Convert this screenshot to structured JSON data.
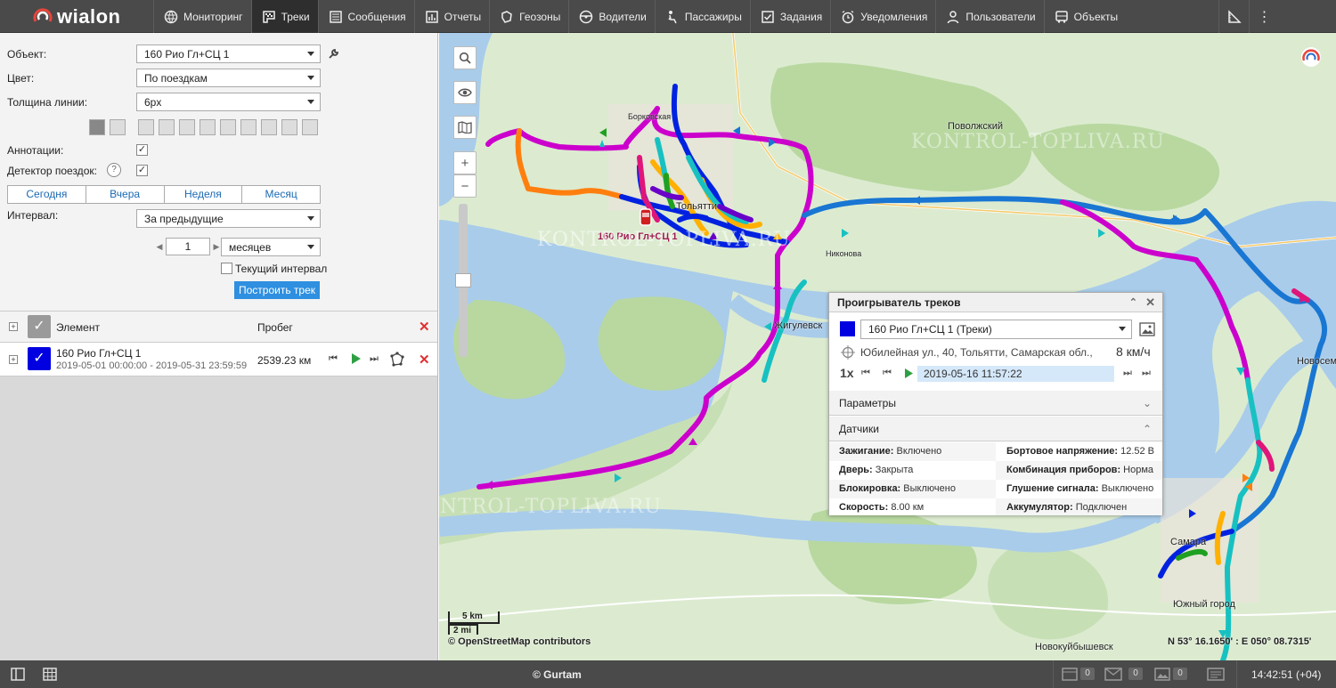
{
  "app": {
    "name": "wialon"
  },
  "nav": {
    "items": [
      {
        "label": "Мониторинг",
        "icon": "globe-icon"
      },
      {
        "label": "Треки",
        "icon": "tracks-icon",
        "active": true
      },
      {
        "label": "Сообщения",
        "icon": "messages-icon"
      },
      {
        "label": "Отчеты",
        "icon": "reports-icon"
      },
      {
        "label": "Геозоны",
        "icon": "geofence-icon"
      },
      {
        "label": "Водители",
        "icon": "steering-wheel-icon"
      },
      {
        "label": "Пассажиры",
        "icon": "passenger-icon"
      },
      {
        "label": "Задания",
        "icon": "tasks-icon"
      },
      {
        "label": "Уведомления",
        "icon": "alarm-clock-icon"
      },
      {
        "label": "Пользователи",
        "icon": "user-icon"
      },
      {
        "label": "Объекты",
        "icon": "bus-icon"
      }
    ]
  },
  "form": {
    "object_label": "Объект:",
    "object_value": "160 Рио Гл+СЦ 1",
    "color_label": "Цвет:",
    "color_value": "По поездкам",
    "width_label": "Толщина линии:",
    "width_value": "6px",
    "annotations_label": "Аннотации:",
    "annotations_checked": true,
    "trip_detector_label": "Детектор поездок:",
    "trip_detector_checked": true,
    "interval_label": "Интервал:",
    "interval_value": "За предыдущие",
    "interval_count": "1",
    "interval_unit": "месяцев",
    "current_interval_label": "Текущий интервал",
    "build_button": "Построить трек"
  },
  "period_tabs": [
    "Сегодня",
    "Вчера",
    "Неделя",
    "Месяц"
  ],
  "list": {
    "header_element": "Элемент",
    "header_mileage": "Пробег",
    "rows": [
      {
        "name": "160 Рио Гл+СЦ 1",
        "period": "2019-05-01 00:00:00 - 2019-05-31 23:59:59",
        "mileage": "2539.23 км",
        "color": "#0000e0"
      }
    ]
  },
  "map": {
    "labels": {
      "tolyatti": "Тольятти",
      "povolzhsky": "Поволжский",
      "zhigulevsk": "Жигулевск",
      "samara": "Самара",
      "novosem": "Новосем",
      "yuzhny": "Южный город",
      "novokuibyshevsk": "Новокуйбышевск",
      "nikonova": "Никонова",
      "borkovskaya": "Борковская",
      "unit_label": "160 Рио Гл+СЦ 1"
    },
    "scale_km": "5 km",
    "scale_mi": "2 mi",
    "attribution": "© OpenStreetMap contributors",
    "coords": "N 53° 16.1650' : E 050° 08.7315'",
    "watermark": "KONTROL-TOPLIVA.RU"
  },
  "player": {
    "title": "Проигрыватель треков",
    "track_name": "160 Рио Гл+СЦ 1 (Треки)",
    "track_color": "#0000e0",
    "address": "Юбилейная ул., 40, Тольятти, Самарская обл., ...",
    "speed": "8 км/ч",
    "speed_mult": "1x",
    "datetime": "2019-05-16 11:57:22",
    "params_label": "Параметры",
    "sensors_label": "Датчики",
    "sensors": [
      {
        "name": "Зажигание:",
        "value": "Включено"
      },
      {
        "name": "Бортовое напряжение:",
        "value": "12.52 В"
      },
      {
        "name": "Дверь:",
        "value": "Закрыта"
      },
      {
        "name": "Комбинация приборов:",
        "value": "Норма"
      },
      {
        "name": "Блокировка:",
        "value": "Выключено"
      },
      {
        "name": "Глушение сигнала:",
        "value": "Выключено"
      },
      {
        "name": "Скорость:",
        "value": "8.00 км"
      },
      {
        "name": "Аккумулятор:",
        "value": "Подключен"
      }
    ]
  },
  "footer": {
    "copyright": "© Gurtam",
    "count_a": "0",
    "count_b": "0",
    "count_c": "0",
    "time": "14:42:51 (+04)"
  }
}
